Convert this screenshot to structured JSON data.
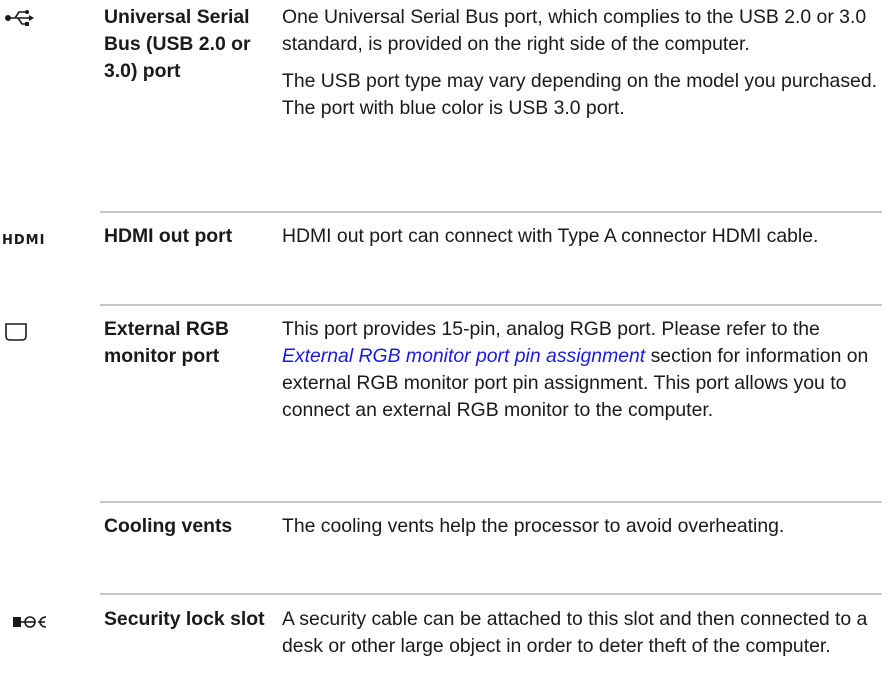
{
  "rows": [
    {
      "icon": "usb-icon",
      "name": "Universal Serial Bus (USB 2.0 or 3.0) port",
      "desc_p1": "One Universal Serial Bus port, which complies to the USB 2.0 or 3.0 standard, is provided on the right side of the computer.",
      "desc_p2": "The USB port type may vary depending on the model you purchased. The port with blue color is USB 3.0 port."
    },
    {
      "icon": "hdmi-icon",
      "icon_text": "HDMI",
      "name": "HDMI out port",
      "desc": "HDMI out port can connect with Type A connector HDMI cable."
    },
    {
      "icon": "rgb-monitor-icon",
      "name": "External RGB monitor port",
      "desc_before": "This port provides 15-pin, analog RGB port. Please refer to the ",
      "desc_link": "External RGB monitor port pin assignment",
      "desc_after": " section for information on external RGB monitor port pin assignment. This port allows you to connect an external RGB monitor to the computer."
    },
    {
      "name": "Cooling vents",
      "desc": "The cooling vents help the processor to avoid overheating."
    },
    {
      "icon": "security-lock-icon",
      "name": "Security lock slot",
      "desc": "A security cable can be attached to this slot and then connected to a desk or other large object in order to deter theft of the computer."
    }
  ],
  "colors": {
    "link": "#1a1ae6",
    "separator": "#c8c8c8",
    "text": "#1a1a1a"
  }
}
